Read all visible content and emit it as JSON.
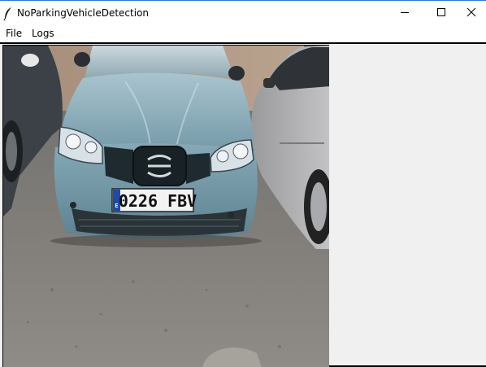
{
  "window": {
    "title": "NoParkingVehicleDetection",
    "controls": {
      "minimize": "minimize-icon",
      "maximize": "maximize-icon",
      "close": "close-icon"
    }
  },
  "menu": {
    "items": [
      {
        "label": "File"
      },
      {
        "label": "Logs"
      }
    ]
  },
  "image": {
    "plate_text": "0226 FBV",
    "plate_country": "E"
  },
  "colors": {
    "title_accent": "#2b79d7",
    "pane_background": "#f0f0f0",
    "car_body": "#7fa3b0",
    "plate_band": "#1f4aa8"
  }
}
